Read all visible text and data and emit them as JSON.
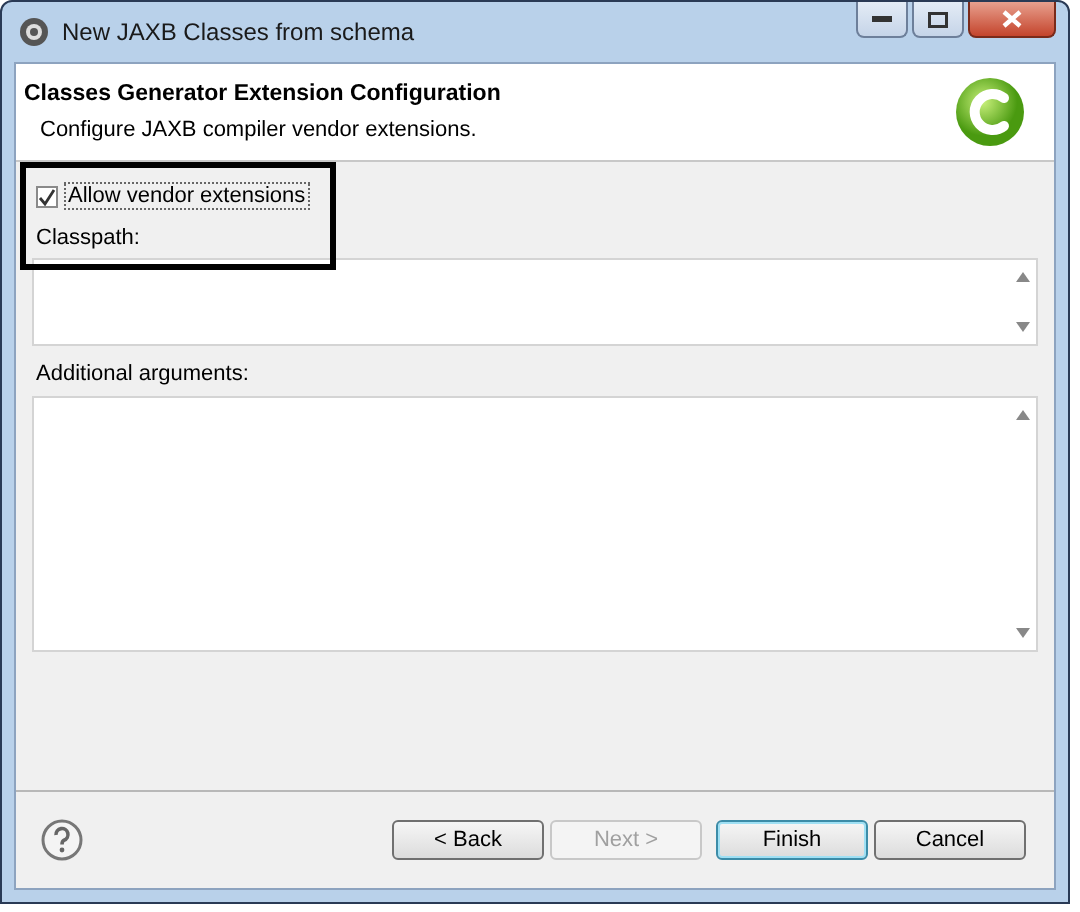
{
  "window": {
    "title": "New JAXB Classes from schema"
  },
  "header": {
    "title": "Classes Generator Extension Configuration",
    "description": "Configure JAXB compiler vendor extensions."
  },
  "vendor_extensions": {
    "label": "Allow vendor extensions",
    "checked": true
  },
  "classpath": {
    "label": "Classpath:"
  },
  "additional_arguments": {
    "label": "Additional arguments:"
  },
  "buttons": [
    {
      "label": "< Back",
      "disabled": false,
      "default": false
    },
    {
      "label": "Next >",
      "disabled": true,
      "default": false
    },
    {
      "label": "Finish",
      "disabled": false,
      "default": true
    },
    {
      "label": "Cancel",
      "disabled": false,
      "default": false
    }
  ]
}
